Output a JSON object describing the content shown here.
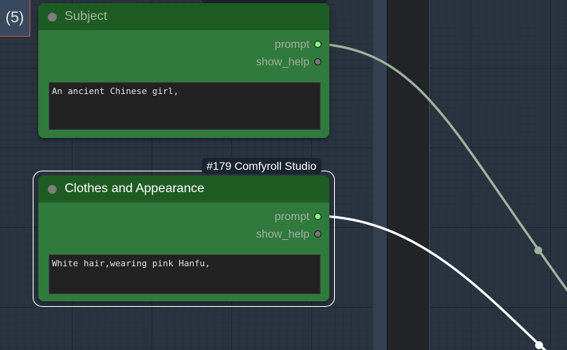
{
  "group": {
    "badge": "(5)"
  },
  "nodes": [
    {
      "title": "Subject",
      "outputs": [
        {
          "label": "prompt",
          "connected": true
        },
        {
          "label": "show_help",
          "connected": false
        }
      ],
      "text": "An ancient Chinese girl,"
    },
    {
      "id_tag": "#179 Comfyroll Studio",
      "title": "Clothes and Appearance",
      "outputs": [
        {
          "label": "prompt",
          "connected": true
        },
        {
          "label": "show_help",
          "connected": false
        }
      ],
      "text": "White hair,wearing pink Hanfu,"
    }
  ],
  "colors": {
    "node_body": "#2f7a3c",
    "node_header": "#1f5c23",
    "link_selected": "#ffffff",
    "link_default": "#9fb3a0",
    "canvas": "#2a3440",
    "group_badge_border": "#c84b52"
  }
}
